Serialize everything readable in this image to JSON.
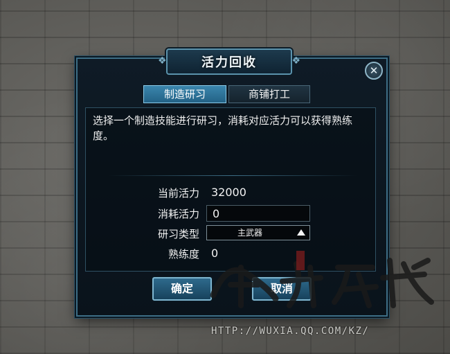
{
  "dialog": {
    "title": "活力回收",
    "close_glyph": "✕"
  },
  "tabs": [
    {
      "label": "制造研习",
      "active": true
    },
    {
      "label": "商铺打工",
      "active": false
    }
  ],
  "description": "选择一个制造技能进行研习，消耗对应活力可以获得熟练度。",
  "form": {
    "current_vitality_label": "当前活力",
    "current_vitality_value": "32000",
    "consume_vitality_label": "消耗活力",
    "consume_vitality_value": "0",
    "study_type_label": "研习类型",
    "study_type_value": "主武器",
    "proficiency_label": "熟练度",
    "proficiency_value": "0"
  },
  "buttons": {
    "confirm": "确定",
    "cancel": "取消"
  },
  "watermark": {
    "logo_text": "逍遥客栈",
    "url": "HTTP://WUXIA.QQ.COM/KZ/"
  },
  "colors": {
    "accent": "#3b86ad",
    "panel": "#0f1b26",
    "border": "#3d6e86"
  },
  "icons": {
    "close": "close-icon",
    "dropdown": "triangle-up-icon"
  }
}
